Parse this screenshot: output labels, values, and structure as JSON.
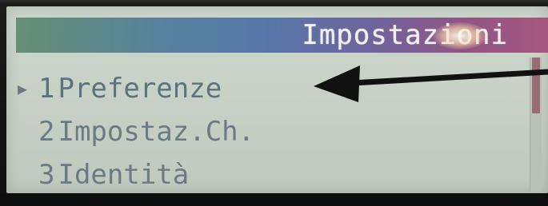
{
  "screen": {
    "title": "Impostazioni"
  },
  "menu": {
    "items": [
      {
        "number": "1",
        "label": "Preferenze",
        "selected": true
      },
      {
        "number": "2",
        "label": "Impostaz.Ch.",
        "selected": false
      },
      {
        "number": "3",
        "label": "Identità",
        "selected": false
      }
    ],
    "cursor_icon": "triangle-right-icon"
  },
  "scrollbar": {
    "position": 0
  },
  "annotation": {
    "icon": "arrow-left-icon",
    "color": "#111111"
  },
  "colors": {
    "lcd_background": "#c6d0c5",
    "menu_text": "#6a7b84",
    "title_text": "#f4f4f4",
    "scroll_thumb": "#9a6b74"
  }
}
